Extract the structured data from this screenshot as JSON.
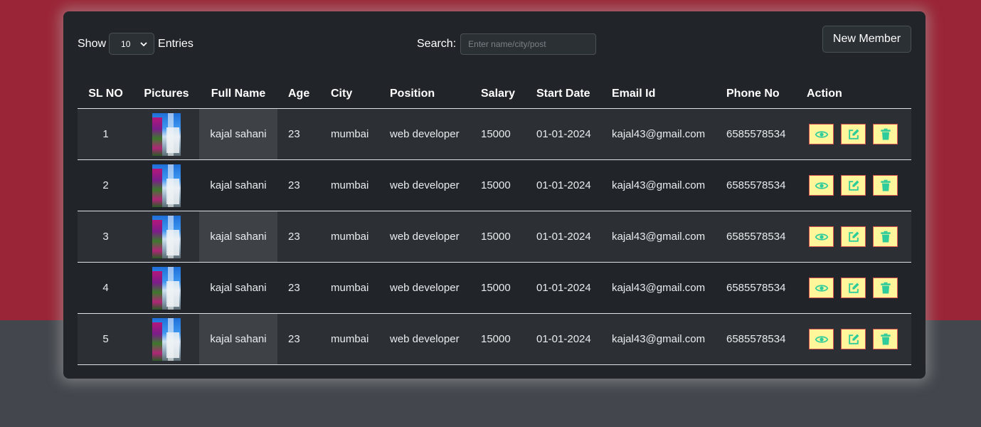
{
  "controls": {
    "show_label": "Show",
    "entries_value": "10",
    "entries_label": "Entries",
    "search_label": "Search:",
    "search_placeholder": "Enter name/city/post",
    "new_member_label": "New Member"
  },
  "table": {
    "headers": [
      "SL NO",
      "Pictures",
      "Full Name",
      "Age",
      "City",
      "Position",
      "Salary",
      "Start Date",
      "Email Id",
      "Phone No",
      "Action"
    ],
    "rows": [
      {
        "sl": "1",
        "name": "kajal sahani",
        "age": "23",
        "city": "mumbai",
        "position": "web developer",
        "salary": "15000",
        "start": "01-01-2024",
        "email": "kajal43@gmail.com",
        "phone": "6585578534"
      },
      {
        "sl": "2",
        "name": "kajal sahani",
        "age": "23",
        "city": "mumbai",
        "position": "web developer",
        "salary": "15000",
        "start": "01-01-2024",
        "email": "kajal43@gmail.com",
        "phone": "6585578534"
      },
      {
        "sl": "3",
        "name": "kajal sahani",
        "age": "23",
        "city": "mumbai",
        "position": "web developer",
        "salary": "15000",
        "start": "01-01-2024",
        "email": "kajal43@gmail.com",
        "phone": "6585578534"
      },
      {
        "sl": "4",
        "name": "kajal sahani",
        "age": "23",
        "city": "mumbai",
        "position": "web developer",
        "salary": "15000",
        "start": "01-01-2024",
        "email": "kajal43@gmail.com",
        "phone": "6585578534"
      },
      {
        "sl": "5",
        "name": "kajal sahani",
        "age": "23",
        "city": "mumbai",
        "position": "web developer",
        "salary": "15000",
        "start": "01-01-2024",
        "email": "kajal43@gmail.com",
        "phone": "6585578534"
      }
    ]
  },
  "icons": {
    "view": "eye-icon",
    "edit": "edit-icon",
    "delete": "trash-icon",
    "select": "chevron-down-icon"
  },
  "colors": {
    "top_bg": "#9a2536",
    "bottom_bg": "#43474d",
    "card_bg": "#212529",
    "action_bg": "#fff59a",
    "action_border": "#d9534f",
    "icon_green": "#2ecc9a"
  }
}
